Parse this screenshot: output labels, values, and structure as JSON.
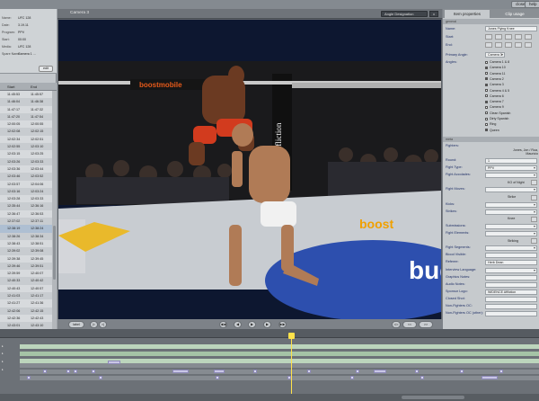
{
  "topbar": {
    "close_label": "close",
    "help_label": "help"
  },
  "left": {
    "info": [
      {
        "label": "Name:",
        "value": "UFC 128"
      },
      {
        "label": "Date:",
        "value": "3.19.11"
      },
      {
        "label": "Program:",
        "value": "PPV"
      },
      {
        "label": "Start:",
        "value": "00:00"
      },
      {
        "label": "Media:",
        "value": "UFC 128"
      },
      {
        "label": "Spare Name:",
        "value": "Camera 1 ..."
      }
    ],
    "refresh_label": "edit",
    "headers": {
      "start": "Start",
      "end": "End"
    },
    "rows": [
      {
        "start": "11:45:53",
        "end": "11:45:57"
      },
      {
        "start": "11:46:04",
        "end": "11:46:38"
      },
      {
        "start": "11:47:17",
        "end": "11:47:32"
      },
      {
        "start": "11:47:20",
        "end": "11:47:54"
      },
      {
        "start": "12:00:05",
        "end": "12:00:55"
      },
      {
        "start": "12:02:08",
        "end": "12:02:15"
      },
      {
        "start": "12:02:34",
        "end": "12:02:51"
      },
      {
        "start": "12:02:55",
        "end": "12:03:10"
      },
      {
        "start": "12:03:15",
        "end": "12:03:25"
      },
      {
        "start": "12:03:26",
        "end": "12:03:33"
      },
      {
        "start": "12:03:36",
        "end": "12:03:44"
      },
      {
        "start": "12:03:46",
        "end": "12:03:52"
      },
      {
        "start": "12:03:57",
        "end": "12:04:06"
      },
      {
        "start": "12:03:16",
        "end": "12:03:24"
      },
      {
        "start": "12:03:28",
        "end": "12:03:33"
      },
      {
        "start": "12:35:44",
        "end": "12:36:16"
      },
      {
        "start": "12:36:47",
        "end": "12:36:53"
      },
      {
        "start": "12:37:02",
        "end": "12:37:11"
      },
      {
        "start": "12:38:19",
        "end": "12:38:24"
      },
      {
        "start": "12:38:26",
        "end": "12:38:34"
      },
      {
        "start": "12:38:43",
        "end": "12:38:51"
      },
      {
        "start": "12:39:02",
        "end": "12:39:08"
      },
      {
        "start": "12:39:38",
        "end": "12:39:45"
      },
      {
        "start": "12:39:46",
        "end": "12:39:51"
      },
      {
        "start": "12:39:59",
        "end": "12:40:07"
      },
      {
        "start": "12:40:33",
        "end": "12:40:42"
      },
      {
        "start": "12:40:43",
        "end": "12:40:57"
      },
      {
        "start": "12:41:03",
        "end": "12:41:17"
      },
      {
        "start": "12:41:27",
        "end": "12:41:36"
      },
      {
        "start": "12:42:06",
        "end": "12:42:15"
      },
      {
        "start": "12:42:36",
        "end": "12:42:43"
      },
      {
        "start": "12:43:01",
        "end": "12:43:10"
      }
    ]
  },
  "video": {
    "title": "Camera 3",
    "angle_button": "Angle Designation",
    "close_label": "x",
    "banners": {
      "top": "boostmobile",
      "side": "Affliction",
      "mat": "bud",
      "mat2": "boost"
    },
    "transport": {
      "left": [
        "label",
        "|<",
        ">|"
      ],
      "center": [
        "◀◀",
        "◀",
        "▶",
        "▶",
        "▶▶"
      ],
      "right": [
        ">|<",
        "<<",
        ">>"
      ]
    }
  },
  "right": {
    "tabs": [
      "Item properties",
      "Clip usage"
    ],
    "general_header": "general",
    "name_label": "Name:",
    "name_value": "Jones Flying Knee",
    "start_label": "Start:",
    "end_label": "End:",
    "primary_angle_label": "Primary Angle:",
    "primary_angle_value": "Camera 3",
    "angles_label": "Angles:",
    "angles": [
      {
        "name": "Camera 1 & 8",
        "on": false
      },
      {
        "name": "Camera 10",
        "on": true
      },
      {
        "name": "Camera 11",
        "on": false
      },
      {
        "name": "Camera 2",
        "on": true
      },
      {
        "name": "Camera 3",
        "on": true
      },
      {
        "name": "Camera 4 & 5",
        "on": false
      },
      {
        "name": "Camera 6",
        "on": false
      },
      {
        "name": "Camera 7",
        "on": true
      },
      {
        "name": "Camera 9",
        "on": false
      },
      {
        "name": "Clean Spanish",
        "on": false
      },
      {
        "name": "Dirty Spanish",
        "on": false
      },
      {
        "name": "Ring",
        "on": false
      },
      {
        "name": "Queen",
        "on": true
      }
    ],
    "meta_header": "meta",
    "fighters_label": "Fighters:",
    "fighters_value": "Jones, Jon / Rua, Mauricio",
    "fields": [
      {
        "label": "Round:",
        "value": "1",
        "dd": false
      },
      {
        "label": "Fight Type:",
        "value": "PPV",
        "dd": true
      },
      {
        "label": "Fight Accolades:",
        "value": "",
        "dd": true
      },
      {
        "label": "",
        "value": "KO of Night",
        "dd": false
      },
      {
        "label": "Fight Moves:",
        "value": "",
        "dd": true
      },
      {
        "label": "",
        "value": "Strike",
        "dd": false
      },
      {
        "label": "Kicks:",
        "value": "",
        "dd": true
      },
      {
        "label": "Strikes:",
        "value": "",
        "dd": true
      },
      {
        "label": "",
        "value": "Knee",
        "dd": false
      },
      {
        "label": "Submissions:",
        "value": "",
        "dd": true
      },
      {
        "label": "Fight Elements:",
        "value": "",
        "dd": true
      },
      {
        "label": "",
        "value": "Striking",
        "dd": false
      },
      {
        "label": "Fight Segments:",
        "value": "",
        "dd": true
      },
      {
        "label": "Blood Visible:",
        "value": "",
        "dd": false
      },
      {
        "label": "Referee:",
        "value": "Herb Dean",
        "dd": false
      },
      {
        "label": "Interview Language:",
        "value": "",
        "dd": true
      },
      {
        "label": "Graphics Notes:",
        "value": "",
        "dd": false
      },
      {
        "label": "Audio Notes:",
        "value": "",
        "dd": false
      },
      {
        "label": "Sponsor Logo:",
        "value": "WIDENCE Affliction",
        "dd": false
      },
      {
        "label": "Closed Shot:",
        "value": "",
        "dd": false
      },
      {
        "label": "Non-Fighters OC:",
        "value": "",
        "dd": false
      },
      {
        "label": "Non-Fighters OC (other):",
        "value": "",
        "dd": false
      }
    ]
  }
}
